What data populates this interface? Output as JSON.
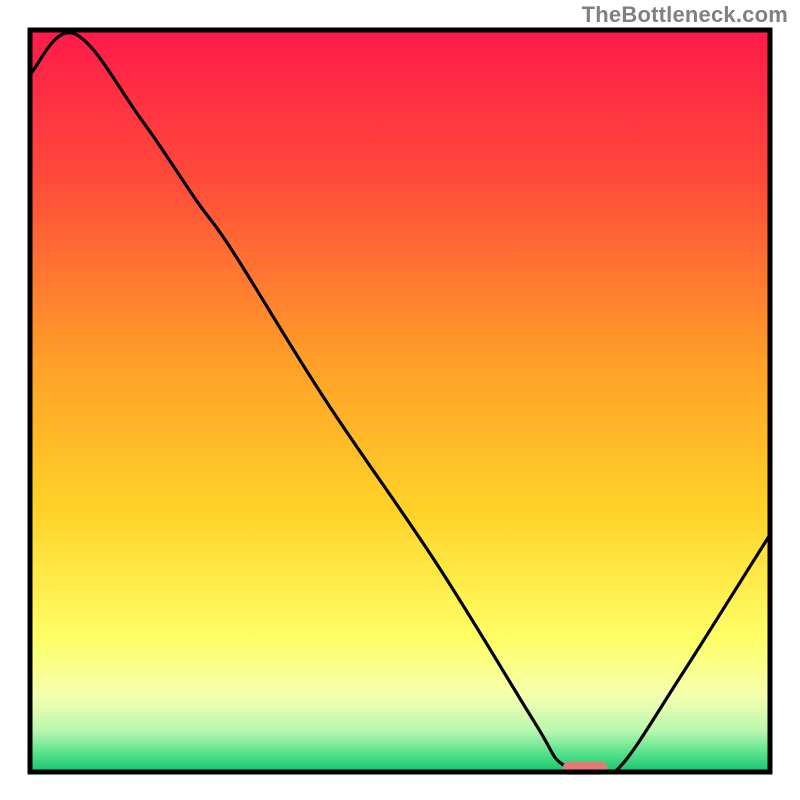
{
  "attribution": "TheBottleneck.com",
  "chart_data": {
    "type": "line",
    "title": "",
    "xlabel": "",
    "ylabel": "",
    "xlim": [
      0,
      100
    ],
    "ylim": [
      0,
      100
    ],
    "background_gradient": {
      "stops": [
        {
          "offset": 0.0,
          "color": "#ff1a4b"
        },
        {
          "offset": 0.2,
          "color": "#ff4a3a"
        },
        {
          "offset": 0.45,
          "color": "#ffa028"
        },
        {
          "offset": 0.65,
          "color": "#ffd328"
        },
        {
          "offset": 0.82,
          "color": "#ffff66"
        },
        {
          "offset": 0.9,
          "color": "#f3ffb0"
        },
        {
          "offset": 0.945,
          "color": "#b8f7b0"
        },
        {
          "offset": 0.975,
          "color": "#56e08a"
        },
        {
          "offset": 1.0,
          "color": "#15c36e"
        }
      ]
    },
    "series": [
      {
        "name": "bottleneck-curve",
        "x": [
          0.0,
          6.0,
          15.0,
          22.5,
          27.5,
          40.0,
          55.0,
          68.0,
          72.0,
          77.0,
          80.0,
          88.0,
          100.0
        ],
        "y": [
          94.0,
          99.5,
          88.0,
          77.0,
          70.0,
          50.0,
          28.0,
          7.0,
          1.0,
          0.5,
          1.0,
          13.0,
          32.0
        ]
      }
    ],
    "marker": {
      "name": "optimal-range",
      "x_start": 72.0,
      "x_end": 78.0,
      "y": 0.5,
      "color": "#e47a76"
    },
    "frame": {
      "stroke": "#000000",
      "stroke_width": 5
    }
  }
}
